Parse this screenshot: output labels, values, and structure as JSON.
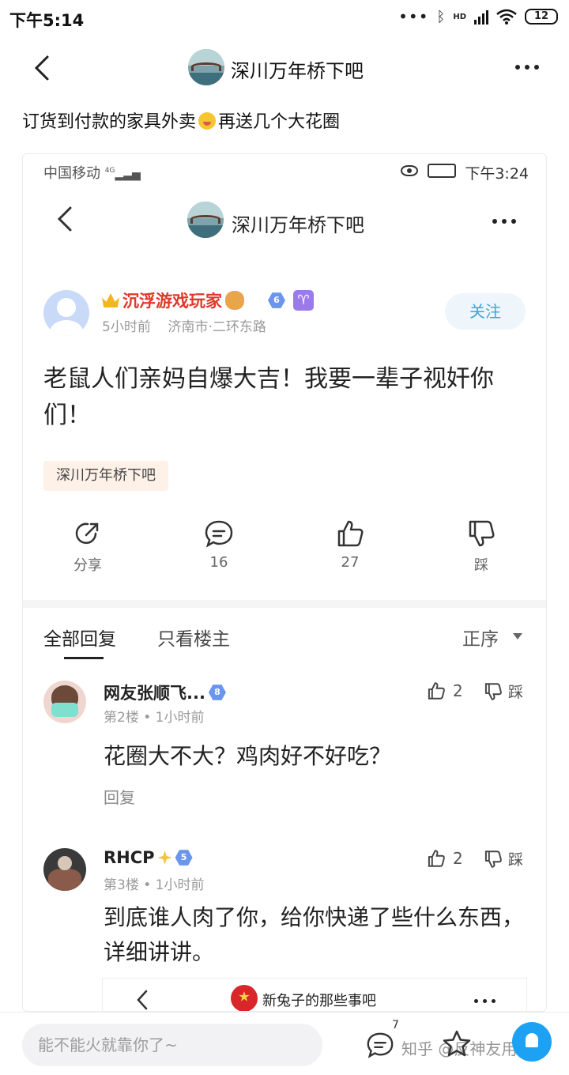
{
  "status_bar": {
    "time": "下午5:14",
    "network": "HD",
    "battery": "12"
  },
  "header": {
    "title": "深川万年桥下吧"
  },
  "post": {
    "title": "订货到付款的家具外卖",
    "title_tail": "再送几个大花圈"
  },
  "screenshot": {
    "status": {
      "carrier": "中国移动",
      "network": "4G",
      "time": "下午3:24"
    },
    "header": {
      "title": "深川万年桥下吧"
    },
    "author": {
      "name": "沉浮游戏玩家",
      "level": "6",
      "zodiac": "♈",
      "time": "5小时前",
      "location": "济南市·二环东路",
      "follow_label": "关注"
    },
    "content": "老鼠人们亲妈自爆大吉！我要一辈子视奸你们！",
    "forum_tag": "深川万年桥下吧",
    "actions": {
      "share": "分享",
      "comments": "16",
      "likes": "27",
      "dislike": "踩"
    },
    "tabs": {
      "all": "全部回复",
      "owner_only": "只看楼主",
      "sort": "正序"
    },
    "replies": [
      {
        "name": "网友张顺飞...",
        "level": "8",
        "floor": "第2楼",
        "time": "1小时前",
        "likes": "2",
        "dislike": "踩",
        "text": "花圈大不大？鸡肉好不好吃？",
        "reply_label": "回复"
      },
      {
        "name": "RHCP",
        "level": "5",
        "floor": "第3楼",
        "time": "1小时前",
        "likes": "2",
        "dislike": "踩",
        "text": "到底谁人肉了你，给你快递了些什么东西，详细讲讲。"
      }
    ],
    "nested": {
      "title": "新兔子的那些事吧"
    }
  },
  "bottom_bar": {
    "input_placeholder": "能不能火就靠你了~",
    "comment_count": "7",
    "watermark": "知乎 @反神友用小号"
  },
  "colors": {
    "accent": "#3ba5dd",
    "username": "#e0392b",
    "badge": "#6b96ee"
  }
}
